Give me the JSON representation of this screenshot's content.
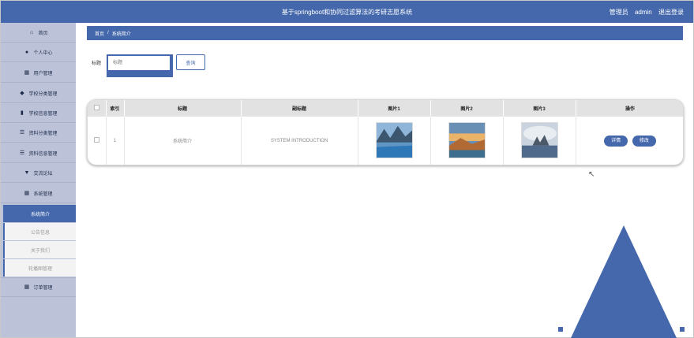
{
  "header": {
    "title": "基于springboot和协同过滤算法的考研志愿系统",
    "role": "管理员",
    "username": "admin",
    "logout": "退出登录"
  },
  "sidebar": {
    "items": [
      {
        "label": "首页",
        "icon": "home-icon"
      },
      {
        "label": "个人中心",
        "icon": "user-icon"
      },
      {
        "label": "用户管理",
        "icon": "grid-icon"
      },
      {
        "label": "学校分类管理",
        "icon": "graduation-cap-icon"
      },
      {
        "label": "学校信息管理",
        "icon": "book-icon"
      },
      {
        "label": "资料分类管理",
        "icon": "list-icon"
      },
      {
        "label": "资料信息管理",
        "icon": "list-icon"
      },
      {
        "label": "交流论坛",
        "icon": "trophy-icon"
      },
      {
        "label": "系统管理",
        "icon": "grid-icon"
      }
    ],
    "sub_items": [
      "系统简介",
      "公告信息",
      "关于我们",
      "轮播图管理"
    ],
    "last_item": {
      "label": "订单管理",
      "icon": "grid-icon"
    }
  },
  "breadcrumb": {
    "home": "首页",
    "separator": "/",
    "current": "系统简介"
  },
  "search": {
    "label": "标题",
    "placeholder": "标题",
    "button": "查询"
  },
  "table": {
    "headers": [
      "索引",
      "标题",
      "副标题",
      "图片1",
      "图片2",
      "图片3",
      "操作"
    ],
    "rows": [
      {
        "index": "1",
        "title": "系统简介",
        "subtitle": "SYSTEM INTRODUCTION",
        "images": [
          "lake-mountain-image",
          "coastal-sunset-image",
          "misty-castle-image"
        ],
        "detail": "详情",
        "edit": "修改"
      }
    ]
  },
  "colors": {
    "primary": "#4468ab",
    "sidebar": "#bcc3d9"
  }
}
